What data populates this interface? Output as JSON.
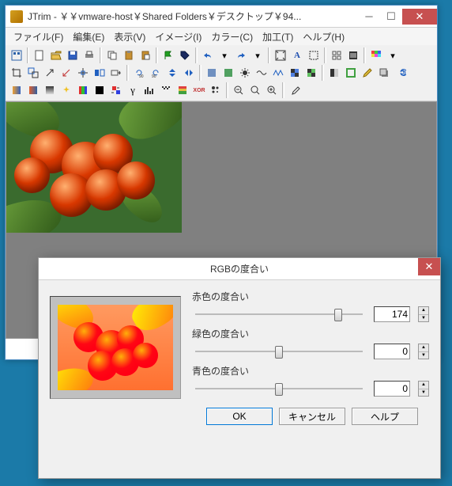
{
  "window": {
    "title": "JTrim - ￥￥vmware-host￥Shared Folders￥デスクトップ￥94...",
    "btn_min": "─",
    "btn_max": "☐",
    "btn_close": "✕"
  },
  "menu": {
    "file": "ファイル(F)",
    "edit": "編集(E)",
    "view": "表示(V)",
    "image": "イメージ(I)",
    "color": "カラー(C)",
    "process": "加工(T)",
    "help": "ヘルプ(H)"
  },
  "dialog": {
    "title": "RGBの度合い",
    "close": "✕",
    "red_label": "赤色の度合い",
    "green_label": "緑色の度合い",
    "blue_label": "青色の度合い",
    "red_value": "174",
    "green_value": "0",
    "blue_value": "0",
    "ok": "OK",
    "cancel": "キャンセル",
    "help": "ヘルプ"
  },
  "chart_data": {
    "type": "table",
    "title": "RGBの度合い",
    "rows": [
      {
        "channel": "赤色の度合い",
        "value": 174,
        "range": [
          -255,
          255
        ]
      },
      {
        "channel": "緑色の度合い",
        "value": 0,
        "range": [
          -255,
          255
        ]
      },
      {
        "channel": "青色の度合い",
        "value": 0,
        "range": [
          -255,
          255
        ]
      }
    ]
  }
}
